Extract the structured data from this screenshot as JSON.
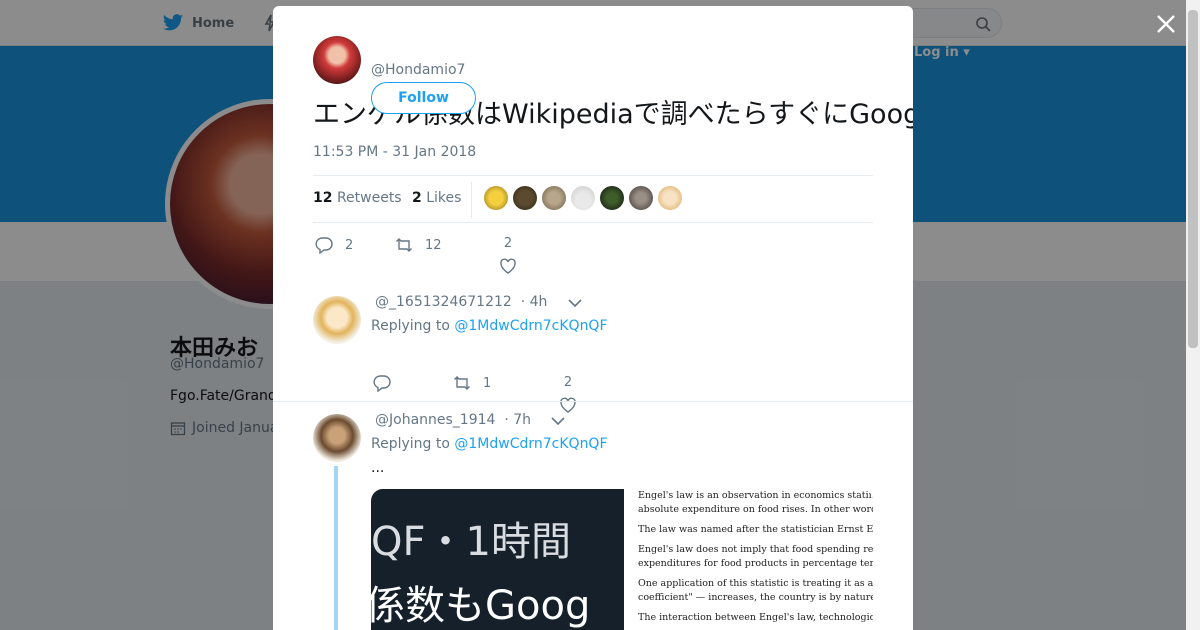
{
  "background": {
    "nav": {
      "home_label": "Home",
      "login_label": "Log in ▾"
    },
    "profile": {
      "name": "本田みお",
      "handle": "@Hondamio7",
      "bio": "Fgo.Fate/Grand",
      "joined": "Joined Janua"
    }
  },
  "modal": {
    "author_handle": "@Hondamio7",
    "follow_label": "Follow",
    "text": "エンゲル係数はWikipediaで調べたらすぐにGoogleの検索結果に出てくるものですね",
    "timestamp": "11:53 PM - 31 Jan 2018",
    "stats": {
      "retweets_count": "12",
      "retweets_label": "Retweets",
      "likes_count": "2",
      "likes_label": "Likes"
    },
    "actions": {
      "reply_count": "2",
      "retweet_count": "12",
      "like_count": "2"
    },
    "replies": [
      {
        "handle": "@_1651324671212",
        "time": "· 4h",
        "replying_prefix": "Replying to",
        "replying_to": "@1MdwCdrn7cKQnQF",
        "actions": {
          "reply_count": "",
          "retweet_count": "1",
          "like_count": "2"
        }
      },
      {
        "handle": "@Johannes_1914",
        "time": "· 7h",
        "replying_prefix": "Replying to",
        "replying_to": "@1MdwCdrn7cKQnQF",
        "text": "...",
        "media": {
          "dark_line1": "QF・1時間",
          "dark_line2": "係数もGoog",
          "article_lines": [
            "Engel's law is an observation in economics stating that",
            "absolute expenditure on food rises. In other words, the",
            "The law was named after the statistician Ernst Engel (",
            "Engel's law does not imply that food spending remains",
            "expenditures for food products in percentage terms les",
            "One application of this statistic is treating it as a refle",
            "coefficient\" — increases, the country is by nature poo",
            "The interaction between Engel's law, technological prog"
          ]
        }
      }
    ]
  },
  "colors": {
    "accent": "#1da1f2",
    "banner": "#1b95e0",
    "thread_line": "#a5d4f5"
  }
}
